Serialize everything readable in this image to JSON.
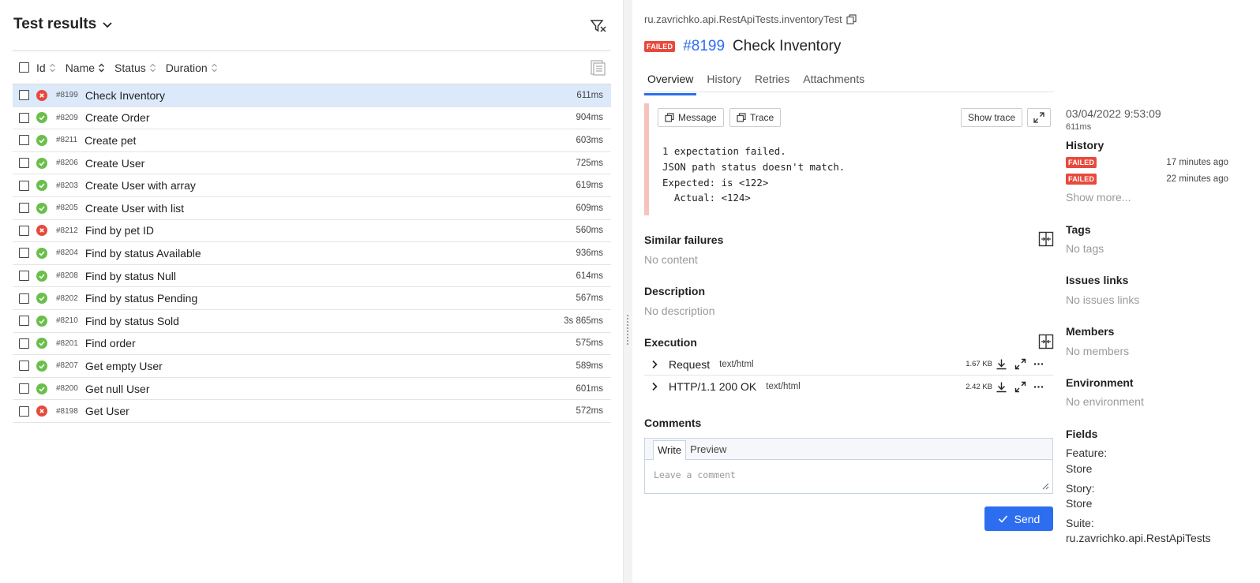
{
  "left": {
    "title": "Test results",
    "columns": {
      "id": "Id",
      "name": "Name",
      "status": "Status",
      "duration": "Duration"
    },
    "rows": [
      {
        "id": "#8199",
        "name": "Check Inventory",
        "status": "failed",
        "duration": "611ms",
        "selected": true
      },
      {
        "id": "#8209",
        "name": "Create Order",
        "status": "passed",
        "duration": "904ms"
      },
      {
        "id": "#8211",
        "name": "Create pet",
        "status": "passed",
        "duration": "603ms"
      },
      {
        "id": "#8206",
        "name": "Create User",
        "status": "passed",
        "duration": "725ms"
      },
      {
        "id": "#8203",
        "name": "Create User with array",
        "status": "passed",
        "duration": "619ms"
      },
      {
        "id": "#8205",
        "name": "Create User with list",
        "status": "passed",
        "duration": "609ms"
      },
      {
        "id": "#8212",
        "name": "Find by pet ID",
        "status": "failed",
        "duration": "560ms"
      },
      {
        "id": "#8204",
        "name": "Find by status Available",
        "status": "passed",
        "duration": "936ms"
      },
      {
        "id": "#8208",
        "name": "Find by status Null",
        "status": "passed",
        "duration": "614ms"
      },
      {
        "id": "#8202",
        "name": "Find by status Pending",
        "status": "passed",
        "duration": "567ms"
      },
      {
        "id": "#8210",
        "name": "Find by status Sold",
        "status": "passed",
        "duration": "3s 865ms"
      },
      {
        "id": "#8201",
        "name": "Find order",
        "status": "passed",
        "duration": "575ms"
      },
      {
        "id": "#8207",
        "name": "Get empty User",
        "status": "passed",
        "duration": "589ms"
      },
      {
        "id": "#8200",
        "name": "Get null User",
        "status": "passed",
        "duration": "601ms"
      },
      {
        "id": "#8198",
        "name": "Get User",
        "status": "failed",
        "duration": "572ms"
      }
    ]
  },
  "detail": {
    "path": "ru.zavrichko.api.RestApiTests.inventoryTest",
    "badge": "FAILED",
    "test_id": "#8199",
    "test_name": "Check Inventory",
    "tabs": [
      "Overview",
      "History",
      "Retries",
      "Attachments"
    ],
    "error": {
      "message_btn": "Message",
      "trace_btn": "Trace",
      "show_trace_btn": "Show trace",
      "text": "1 expectation failed.\nJSON path status doesn't match.\nExpected: is <122>\n  Actual: <124>"
    },
    "similar_failures": {
      "title": "Similar failures",
      "empty": "No content"
    },
    "description": {
      "title": "Description",
      "empty": "No description"
    },
    "execution": {
      "title": "Execution",
      "items": [
        {
          "name": "Request",
          "type": "text/html",
          "size": "1.67 KB"
        },
        {
          "name": "HTTP/1.1 200 OK",
          "type": "text/html",
          "size": "2.42 KB"
        }
      ]
    },
    "comments": {
      "title": "Comments",
      "write_tab": "Write",
      "preview_tab": "Preview",
      "placeholder": "Leave a comment",
      "send": "Send"
    }
  },
  "sidebar": {
    "date": "03/04/2022 9:53:09",
    "duration": "611ms",
    "history_title": "History",
    "history": [
      {
        "badge": "FAILED",
        "ago": "17 minutes ago"
      },
      {
        "badge": "FAILED",
        "ago": "22 minutes ago"
      }
    ],
    "show_more": "Show more...",
    "tags_title": "Tags",
    "tags_empty": "No tags",
    "issues_title": "Issues links",
    "issues_empty": "No issues links",
    "members_title": "Members",
    "members_empty": "No members",
    "environment_title": "Environment",
    "environment_empty": "No environment",
    "fields_title": "Fields",
    "fields": [
      {
        "label": "Feature:",
        "value": "Store"
      },
      {
        "label": "Story:",
        "value": "Store"
      },
      {
        "label": "Suite:",
        "value": "ru.zavrichko.api.RestApiTests"
      }
    ]
  },
  "colors": {
    "accent": "#2d6ef0",
    "failed": "#e8493c",
    "passed": "#6abf4b",
    "selected_row": "#dbe9fb"
  }
}
